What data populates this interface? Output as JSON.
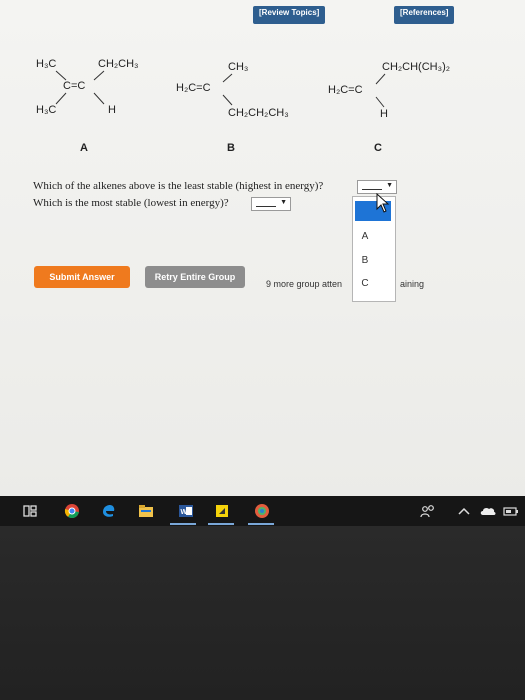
{
  "header": {
    "review_topics": "[Review Topics]",
    "references": "[References]"
  },
  "molecules": {
    "A": {
      "top_left": "H₃C",
      "top_right": "CH₂CH₃",
      "double_bond": "C=C",
      "bottom_left": "H₃C",
      "bottom_right": "H"
    },
    "B": {
      "top": "CH₃",
      "double_bond": "H₂C=C",
      "bottom": "CH₂CH₂CH₃"
    },
    "C": {
      "top": "CH₂CH(CH₃)₂",
      "double_bond": "H₂C=C",
      "bottom": "H"
    }
  },
  "labels": [
    "A",
    "B",
    "C"
  ],
  "questions": {
    "least_stable": "Which of the alkenes above is the least stable (highest in energy)?",
    "most_stable": "Which is the most stable (lowest in energy)?"
  },
  "dropdown_options": [
    "A",
    "B",
    "C"
  ],
  "buttons": {
    "submit": "Submit Answer",
    "retry": "Retry Entire Group"
  },
  "status": {
    "attempts": "9 more group atten",
    "remaining": "aining"
  },
  "colors": {
    "submit": "#ef7a1e",
    "retry": "#8d8d8d",
    "link_bg": "#2e5e8f",
    "highlight": "#1e74d6"
  }
}
